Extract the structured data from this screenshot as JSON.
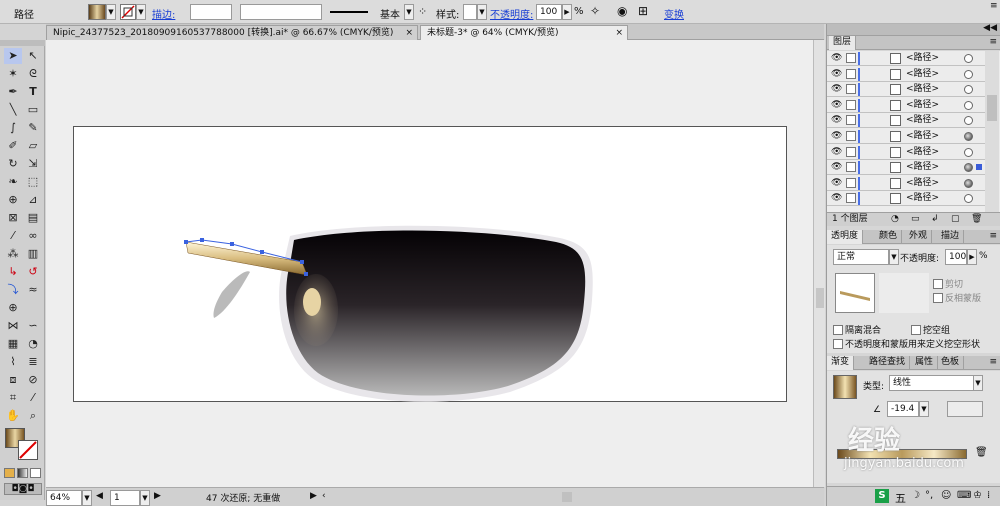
{
  "control_bar": {
    "object_type": "路径",
    "stroke_label": "描边:",
    "stroke_weight": "",
    "brush_profile": "基本",
    "style_label": "样式:",
    "opacity_label": "不透明度:",
    "opacity_value": "100",
    "opacity_unit": "%",
    "transform_label": "变换"
  },
  "document_tabs": [
    {
      "title": "Nipic_24377523_20180909160537788000 [转换].ai* @ 66.67% (CMYK/预览)",
      "active": false
    },
    {
      "title": "未标题-3* @ 64% (CMYK/预览)",
      "active": true
    }
  ],
  "layers_panel": {
    "title": "图层",
    "rows": [
      "<路径>",
      "<路径>",
      "<路径>",
      "<路径>",
      "<路径>",
      "<路径>",
      "<路径>",
      "<路径>",
      "<路径>",
      "<路径>"
    ],
    "footer_count": "1 个图层"
  },
  "transparency_panel": {
    "tabs": [
      "透明度",
      "颜色",
      "外观",
      "描边"
    ],
    "blend_mode": "正常",
    "opacity_label": "不透明度:",
    "opacity_value": "100",
    "opacity_unit": "%",
    "clip_label": "剪切",
    "invert_mask_label": "反相蒙版",
    "isolate_blend_label": "隔离混合",
    "knockout_group_label": "挖空组",
    "opacity_mask_label": "不透明度和蒙版用来定义挖空形状"
  },
  "gradient_panel": {
    "tabs": [
      "渐变",
      "路径查找",
      "属性",
      "色板"
    ],
    "type_label": "类型:",
    "type_value": "线性",
    "angle_value": "-19.4"
  },
  "status_bar": {
    "zoom": "64%",
    "artboard_num": "1",
    "status_text": "47 次还原; 无重做"
  },
  "watermark": {
    "logo_text": "经验",
    "url_text": "jingyan.baidu.com",
    "ime_label": "五"
  },
  "colors": {
    "ui_bg": "#d4d4d4",
    "canvas": "#eeeeee",
    "accent_blue": "#4a6fe6",
    "link": "#1a3fd4",
    "gold_light": "#f3e2b2",
    "gold_dark": "#8a6a30"
  },
  "icons": [
    "selection-arrow-icon",
    "direct-select-icon",
    "magic-wand-icon",
    "lasso-icon",
    "pen-icon",
    "type-icon",
    "line-icon",
    "rectangle-icon",
    "paintbrush-icon",
    "pencil-icon",
    "blob-brush-icon",
    "eraser-icon",
    "rotate-icon",
    "scale-icon",
    "warp-icon",
    "free-transform-icon",
    "shape-builder-icon",
    "perspective-icon",
    "mesh-icon",
    "gradient-icon",
    "eyedropper-icon",
    "blend-icon",
    "symbol-sprayer-icon",
    "column-graph-icon",
    "artboard-icon",
    "slice-icon",
    "hand-icon",
    "zoom-icon",
    "eye-icon",
    "target-icon"
  ]
}
